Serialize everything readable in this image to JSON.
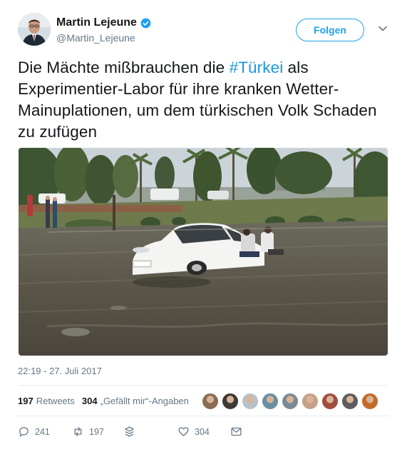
{
  "user": {
    "display_name": "Martin Lejeune",
    "handle": "@Martin_Lejeune",
    "verified": true
  },
  "follow_label": "Folgen",
  "tweet": {
    "text_before": "Die Mächte mißbrauchen die ",
    "hashtag": "#Türkei",
    "text_after": " als Experimentier-Labor für ihre kranken Wetter-Mainuplationen, um dem türkischen Volk Schaden zu zufügen"
  },
  "timestamp": "22:19 - 27. Juli 2017",
  "stats": {
    "retweets_count": "197",
    "retweets_label": "Retweets",
    "likes_count": "304",
    "likes_label": "„Gefällt mir“-Angaben"
  },
  "actions": {
    "reply_count": "241",
    "retweet_count": "197",
    "like_count": "304"
  },
  "colors": {
    "accent": "#1da1f2",
    "hashtag": "#1b95e0",
    "muted": "#657786"
  },
  "liker_colors": [
    "#8a6d52",
    "#3f3a36",
    "#b8c0c8",
    "#6b8fa5",
    "#7c8a96",
    "#c7a08a",
    "#9e4f3c",
    "#5d5d5d",
    "#c46a2b"
  ]
}
